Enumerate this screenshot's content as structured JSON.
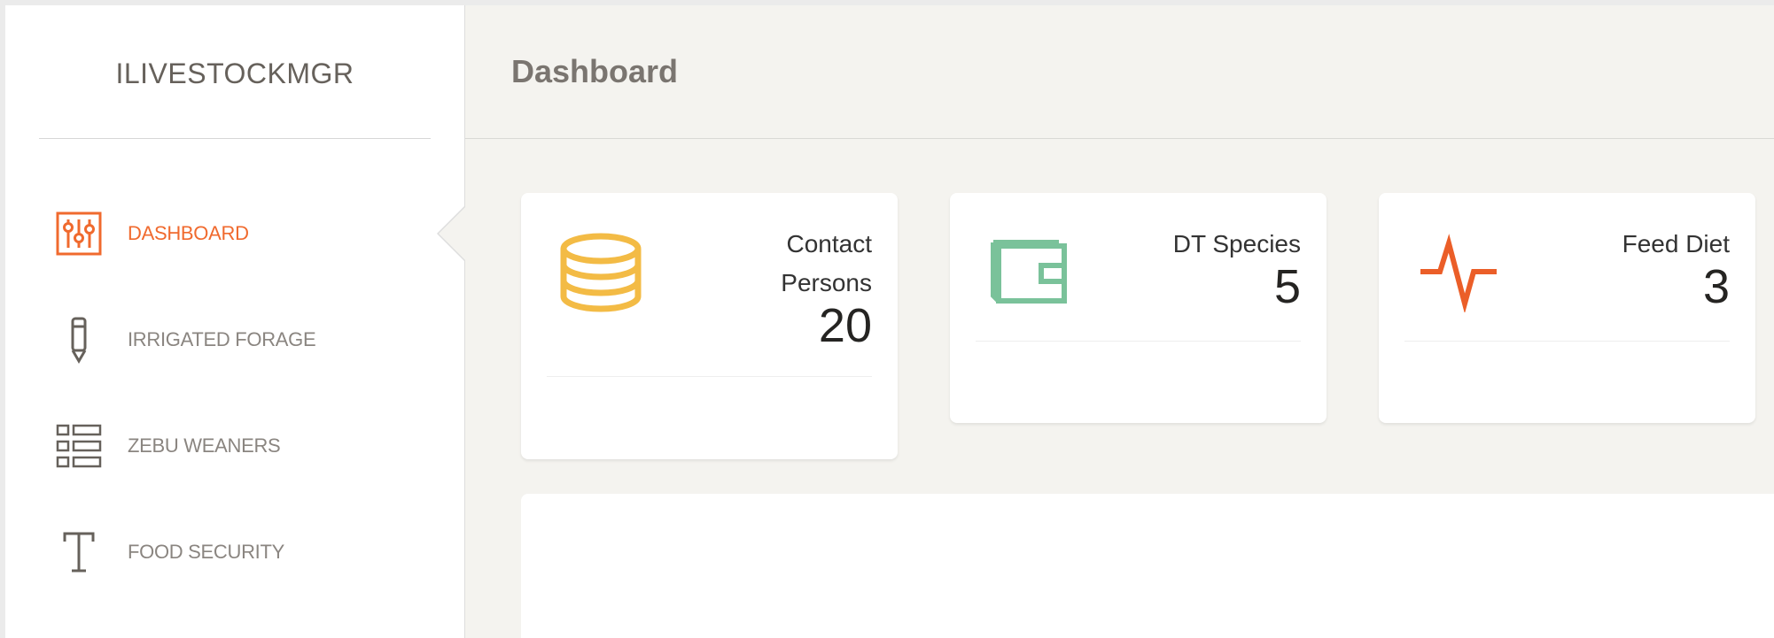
{
  "sidebar": {
    "logo": "ILIVESTOCKMGR",
    "items": [
      {
        "label": "DASHBOARD",
        "icon": "sliders-icon",
        "active": true
      },
      {
        "label": "IRRIGATED FORAGE",
        "icon": "pen-icon",
        "active": false
      },
      {
        "label": "ZEBU WEANERS",
        "icon": "list-icon",
        "active": false
      },
      {
        "label": "FOOD SECURITY",
        "icon": "text-icon",
        "active": false
      }
    ]
  },
  "header": {
    "title": "Dashboard"
  },
  "cards": [
    {
      "label_line1": "Contact",
      "label_line2": "Persons",
      "value": "20",
      "icon": "coins-icon",
      "color": "#f3bb45"
    },
    {
      "label_line1": "DT Species",
      "value": "5",
      "icon": "wallet-icon",
      "color": "#7ac29a"
    },
    {
      "label_line1": "Feed Diet",
      "value": "3",
      "icon": "pulse-icon",
      "color": "#eb5e28"
    }
  ],
  "colors": {
    "accent": "#f06a2e",
    "muted": "#8a8580",
    "background": "#f4f3ef"
  }
}
